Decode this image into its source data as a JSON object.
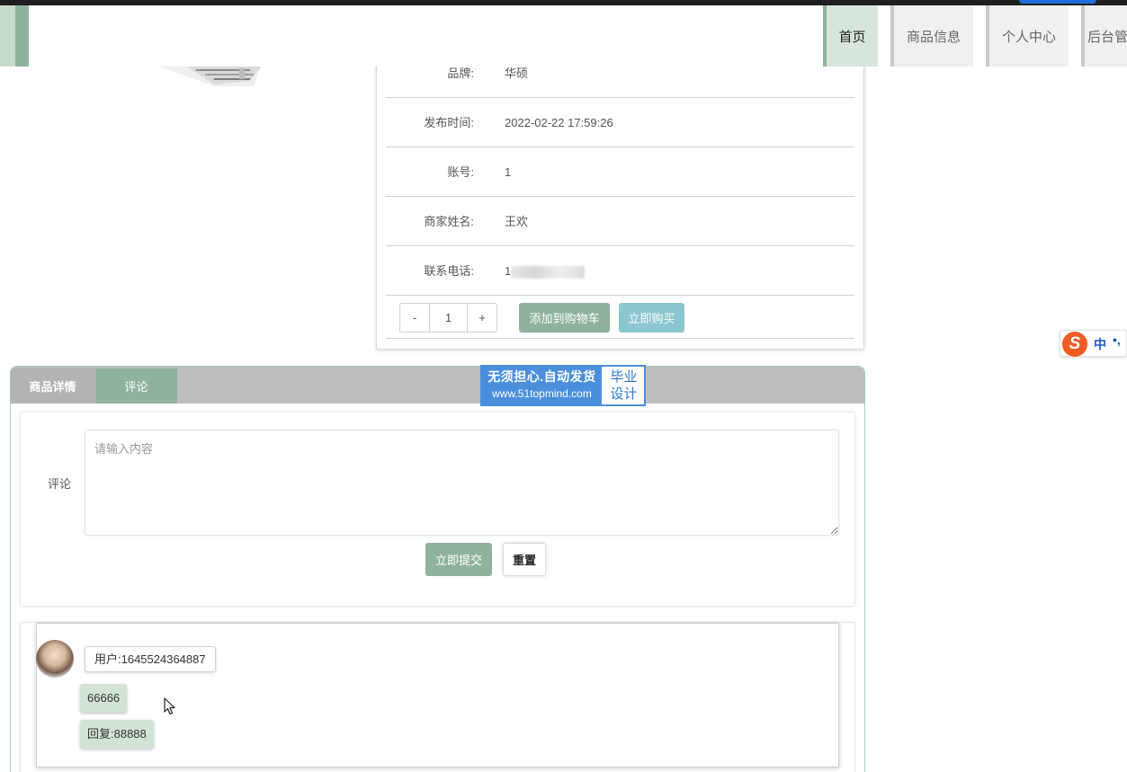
{
  "nav": {
    "items": [
      {
        "label": "首页",
        "active": true
      },
      {
        "label": "商品信息",
        "active": false
      },
      {
        "label": "个人中心",
        "active": false
      },
      {
        "label": "后台管理",
        "active": false
      }
    ]
  },
  "product": {
    "fields": [
      {
        "label": "品牌:",
        "value": "华硕"
      },
      {
        "label": "发布时间:",
        "value": "2022-02-22 17:59:26"
      },
      {
        "label": "账号:",
        "value": "1"
      },
      {
        "label": "商家姓名:",
        "value": "王欢"
      },
      {
        "label": "联系电话:",
        "value": "1"
      }
    ],
    "quantity": {
      "minus": "-",
      "value": "1",
      "plus": "+"
    },
    "add_to_cart": "添加到购物车",
    "buy_now": "立即购买"
  },
  "ime": {
    "mode": "中",
    "punct": "•,"
  },
  "watermark": {
    "line1": "无须担心.自动发货",
    "line2": "www.51topmind.com",
    "right_top": "毕业",
    "right_bottom": "设计"
  },
  "tabs": [
    {
      "label": "商品详情",
      "active": false
    },
    {
      "label": "评论",
      "active": true
    }
  ],
  "comment_form": {
    "label": "评论",
    "placeholder": "请输入内容",
    "submit": "立即提交",
    "reset": "重置"
  },
  "comments": [
    {
      "user": "用户:1645524364887",
      "content": "66666",
      "reply": "回复:88888"
    }
  ],
  "colors": {
    "accent": "#8fb29d",
    "buy": "#8cc6cf",
    "nav_active": "#d7e5da",
    "watermark_blue": "#4a8fdc"
  }
}
